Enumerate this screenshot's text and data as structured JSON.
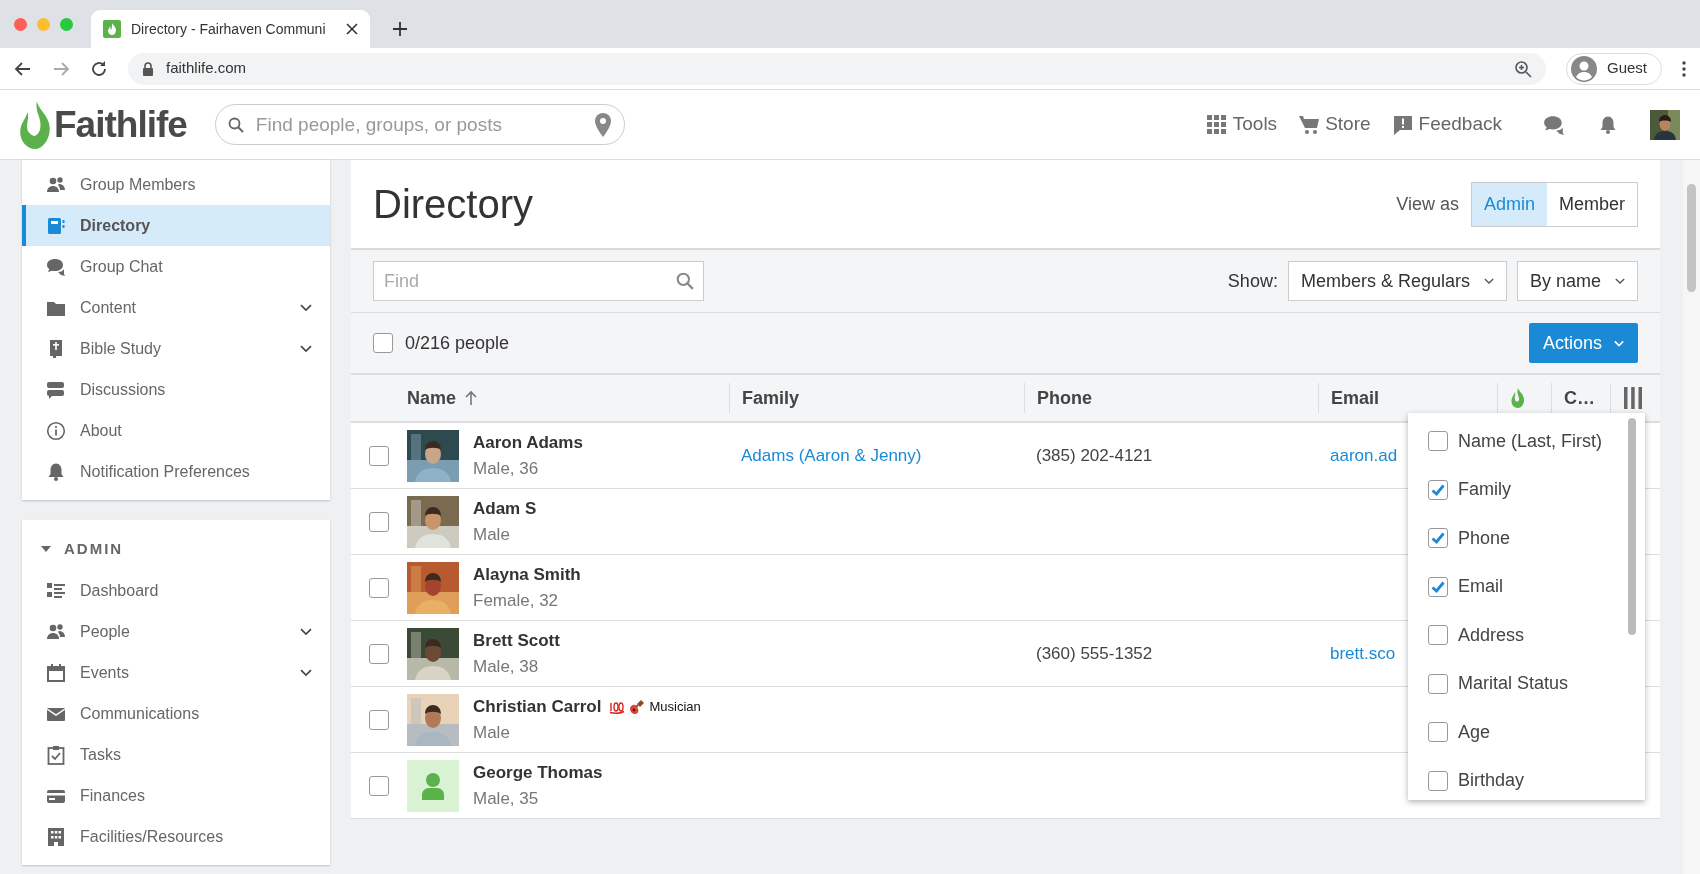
{
  "browser": {
    "tab_title": "Directory - Fairhaven Communi",
    "url": "faithlife.com",
    "profile": "Guest"
  },
  "header": {
    "logo": "Faithlife",
    "search": {
      "placeholder": "Find people, groups, or posts"
    },
    "nav": [
      "Tools",
      "Store",
      "Feedback"
    ]
  },
  "sidebar": {
    "items": [
      {
        "label": "Group Members",
        "selected": false,
        "has_submenu": false
      },
      {
        "label": "Directory",
        "selected": true,
        "has_submenu": false
      },
      {
        "label": "Group Chat",
        "selected": false,
        "has_submenu": false
      },
      {
        "label": "Content",
        "selected": false,
        "has_submenu": true
      },
      {
        "label": "Bible Study",
        "selected": false,
        "has_submenu": true
      },
      {
        "label": "Discussions",
        "selected": false,
        "has_submenu": false
      },
      {
        "label": "About",
        "selected": false,
        "has_submenu": false
      },
      {
        "label": "Notification Preferences",
        "selected": false,
        "has_submenu": false
      }
    ],
    "admin": {
      "heading": "ADMIN",
      "expanded": true,
      "items": [
        {
          "label": "Dashboard",
          "selected": false,
          "has_submenu": false
        },
        {
          "label": "People",
          "selected": false,
          "has_submenu": true
        },
        {
          "label": "Events",
          "selected": false,
          "has_submenu": true
        },
        {
          "label": "Communications",
          "selected": false,
          "has_submenu": false
        },
        {
          "label": "Tasks",
          "selected": false,
          "has_submenu": false
        },
        {
          "label": "Finances",
          "selected": false,
          "has_submenu": false
        },
        {
          "label": "Facilities/Resources",
          "selected": false,
          "has_submenu": false
        }
      ]
    }
  },
  "main": {
    "title": "Directory",
    "view_as": {
      "label": "View as",
      "options": [
        {
          "label": "Admin",
          "selected": true
        },
        {
          "label": "Member",
          "selected": false
        }
      ]
    },
    "find": {
      "placeholder": "Find"
    },
    "show": {
      "label": "Show:",
      "audience": "Members & Regulars",
      "sort": "By name"
    },
    "selection": {
      "checked": false,
      "count": "0/216 people"
    },
    "actions": "Actions",
    "table": {
      "columns": [
        {
          "kind": "text",
          "label": "Name",
          "sorted_ascending": true
        },
        {
          "kind": "text",
          "label": "Family"
        },
        {
          "kind": "text",
          "label": "Phone"
        },
        {
          "kind": "text",
          "label": "Email"
        },
        {
          "kind": "icon"
        },
        {
          "kind": "text",
          "label": "C…"
        }
      ],
      "rows": [
        {
          "checked": false,
          "has_photo": true,
          "name": "Aaron Adams",
          "detail": "Male, 36",
          "family": "Adams (Aaron & Jenny)",
          "phone": "(385) 202-4121",
          "email": "aaron.ad"
        },
        {
          "checked": false,
          "has_photo": true,
          "name": "Adam S",
          "detail": "Male"
        },
        {
          "checked": false,
          "has_photo": true,
          "name": "Alayna Smith",
          "detail": "Female, 32"
        },
        {
          "checked": false,
          "has_photo": true,
          "name": "Brett Scott",
          "detail": "Male, 38",
          "phone": "(360) 555-1352",
          "email": "brett.sco"
        },
        {
          "checked": false,
          "has_photo": true,
          "name": "Christian Carrol",
          "badge": "Musician",
          "detail": "Male"
        },
        {
          "checked": false,
          "has_photo": false,
          "name": "George Thomas",
          "detail": "Male, 35"
        }
      ]
    },
    "column_picker": [
      {
        "label": "Name (Last, First)",
        "checked": false
      },
      {
        "label": "Family",
        "checked": true
      },
      {
        "label": "Phone",
        "checked": true
      },
      {
        "label": "Email",
        "checked": true
      },
      {
        "label": "Address",
        "checked": false
      },
      {
        "label": "Marital Status",
        "checked": false
      },
      {
        "label": "Age",
        "checked": false
      },
      {
        "label": "Birthday",
        "checked": false
      }
    ]
  }
}
